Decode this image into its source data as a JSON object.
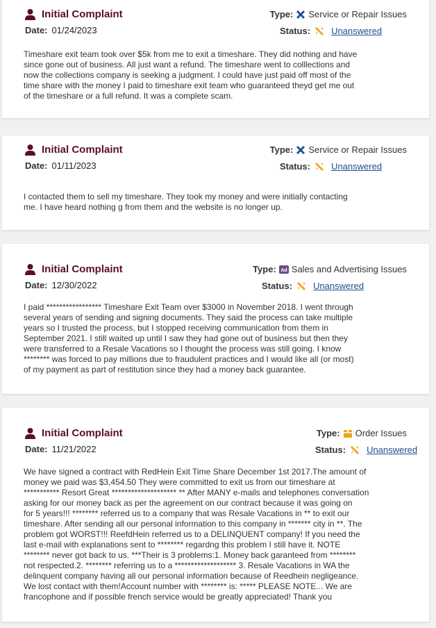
{
  "labels": {
    "title": "Initial Complaint",
    "date": "Date:",
    "type": "Type:",
    "status": "Status:"
  },
  "complaints": [
    {
      "date": "01/24/2023",
      "type": "Service or Repair Issues",
      "type_icon": "tools-icon",
      "status": "Unanswered",
      "text": "Timeshare exit team took over $5k from me to exit a timeshare. They did nothing and have\nsince gone out of business. All just want a refund. The timeshare went to colllections and\nnow the collections company is seeking a judgment. I could have just paid off most of the\ntime share with the money I paid to timeshare exit team who guaranteed theyd get me out\nof the timeshare or a full refund. It was a complete scam."
    },
    {
      "date": "01/11/2023",
      "type": "Service or Repair Issues",
      "type_icon": "tools-icon",
      "status": "Unanswered",
      "text": "I contacted them to sell my timeshare. They took my money and were initially contacting\nme. I have heard nothing g from them and the website is no longer up."
    },
    {
      "date": "12/30/2022",
      "type": "Sales and Advertising Issues",
      "type_icon": "ad-icon",
      "status": "Unanswered",
      "text": "I paid ***************** Timeshare Exit Team over $3000 in November 2018. I went through\nseveral years of sending and signing documents. They said the process can take multiple\nyears so I trusted the process, but I stopped receiving communication from them in\nSeptember 2021. I still waited up until I saw they had gone out of business but then they\nwere transferred to a Resale Vacations so I thought the process was still going. I know\n******** was forced to pay millions due to fraudulent practices and I would like all (or most)\nof my payment as part of restitution since they had a money back guarantee."
    },
    {
      "date": "11/21/2022",
      "type": "Order Issues",
      "type_icon": "package-icon",
      "status": "Unanswered",
      "text": "We have signed a contract with RedHein Exit Time Share December 1st 2017.The amount of\nmoney we paid was $3,454.50 They were committed to exit us from our timeshare at\n*********** Resort Great ******************** ** After MANY e-mails and telephones conversation\nasking for our money back as per the agreement on our contract because it was going on\nfor 5 years!!! ******** referred us to a company that was Resale Vacations in ** to exit our\ntimeshare. After sending all our personal information to this company in ******* city in **. The\nproblem got WORST!!! ReefdHein referred us to a DELINQUENT company! If you need the\nlast e-mail with explanations sent to ******** regardng this problem I still have it. NOTE\n******** never got back to us. ***Their is 3 problems:1. Money back garanteed from ********\nnot respected.2. ******** referring us to a ******************* 3. Resale Vacations in WA the\ndelinquent company having all our personal information because of Reedhein negligeance.\nWe lost contact with them!Account number with ******** is: ***** PLEASE NOTE... We are\nfrancophone and if possible french service would be greatly appreciated! Thank you"
    }
  ]
}
